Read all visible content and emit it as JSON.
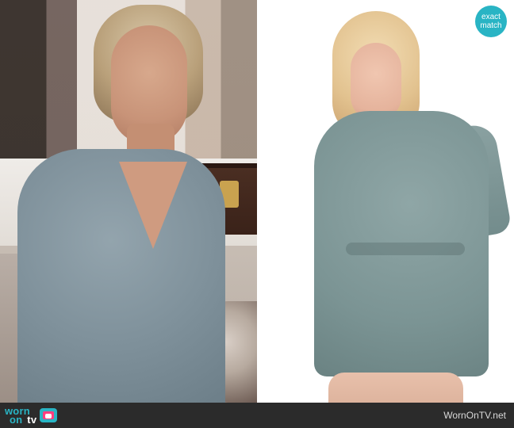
{
  "badge": {
    "line1": "exact",
    "line2": "match"
  },
  "footer": {
    "brand_worn": "worn",
    "brand_on": "on",
    "brand_tv": "tv",
    "site_url": "WornOnTV.net"
  },
  "colors": {
    "accent": "#29b4c4",
    "footer_bg": "#2b2b2b",
    "romper": "#7b9494",
    "shirt": "#7f919b"
  }
}
